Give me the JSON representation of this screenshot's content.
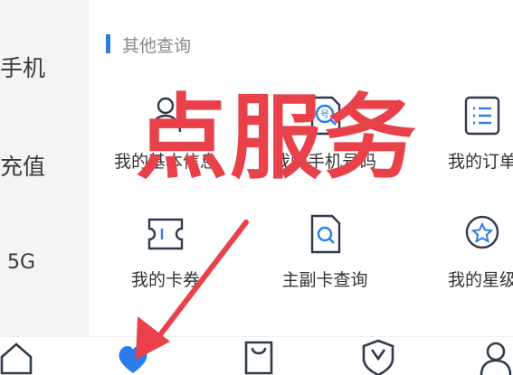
{
  "sidebar": {
    "items": [
      {
        "label": "手机"
      },
      {
        "label": "充值"
      },
      {
        "label": "5G"
      }
    ]
  },
  "section": {
    "title": "其他查询"
  },
  "services": [
    {
      "label": "我的基本信息",
      "icon": "person-doc-icon"
    },
    {
      "label": "我的手机号码",
      "icon": "number-search-icon"
    },
    {
      "label": "我的订单",
      "icon": "order-list-icon"
    },
    {
      "label": "我的卡券",
      "icon": "coupon-icon"
    },
    {
      "label": "主副卡查询",
      "icon": "doc-search-icon"
    },
    {
      "label": "我的星级",
      "icon": "star-badge-icon"
    }
  ],
  "overlay": {
    "text": "点服务",
    "color": "#e8414a"
  },
  "bottom_nav": {
    "tabs": [
      {
        "icon": "home-icon"
      },
      {
        "icon": "service-heart-icon",
        "active": true
      },
      {
        "icon": "shopping-bag-icon"
      },
      {
        "icon": "shield-v-icon"
      },
      {
        "icon": "person-icon"
      }
    ]
  },
  "colors": {
    "accent": "#2b7ce9",
    "annotation": "#e8414a"
  }
}
